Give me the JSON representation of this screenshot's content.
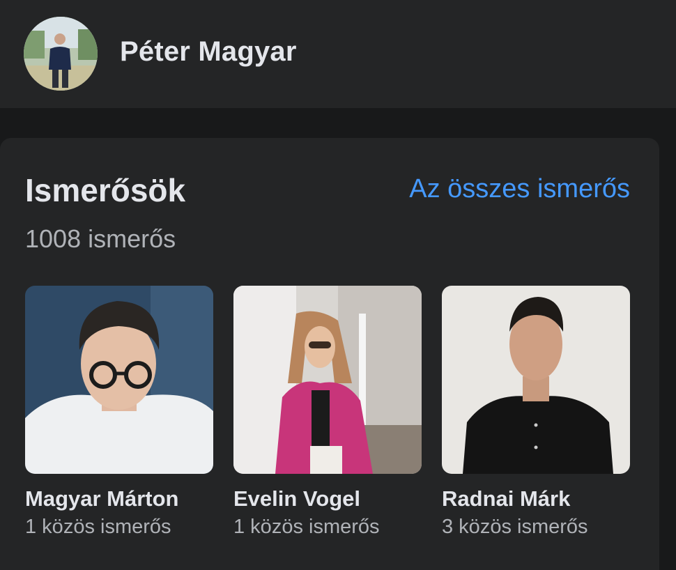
{
  "profile": {
    "name": "Péter Magyar"
  },
  "friends_section": {
    "title": "Ismerősök",
    "see_all_label": "Az összes ismerős",
    "count_text": "1008 ismerős",
    "friends": [
      {
        "name": "Magyar Márton",
        "mutual": "1 közös ismerős"
      },
      {
        "name": "Evelin Vogel",
        "mutual": "1 közös ismerős"
      },
      {
        "name": "Radnai Márk",
        "mutual": "3 közös ismerős"
      }
    ]
  }
}
